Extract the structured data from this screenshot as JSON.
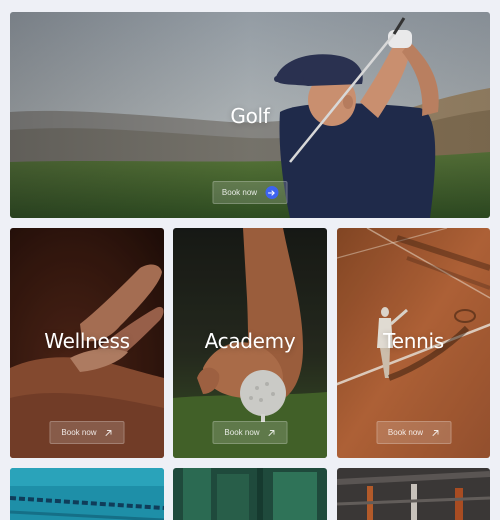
{
  "cards": {
    "golf": {
      "title": "Golf",
      "button": "Book now"
    },
    "wellness": {
      "title": "Wellness",
      "button": "Book now"
    },
    "academy": {
      "title": "Academy",
      "button": "Book now"
    },
    "tennis": {
      "title": "Tennis",
      "button": "Book now"
    }
  },
  "colors": {
    "page_background": "#eef0f6",
    "accent": "#3d63f0",
    "text": "#ffffff"
  },
  "icons": {
    "golf_button": "arrow-right-icon",
    "small_buttons": "arrow-up-right-icon"
  }
}
